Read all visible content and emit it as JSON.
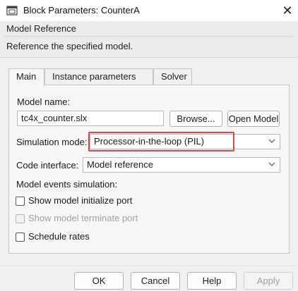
{
  "window": {
    "title": "Block Parameters: CounterA",
    "icon": "block-parameters-icon",
    "close_glyph": "✕"
  },
  "section": {
    "title": "Model Reference",
    "description": "Reference the specified model."
  },
  "tabs": [
    {
      "label": "Main",
      "active": true
    },
    {
      "label": "Instance parameters",
      "active": false
    },
    {
      "label": "Solver",
      "active": false
    }
  ],
  "main": {
    "model_name_label": "Model name:",
    "model_name_value": "tc4x_counter.slx",
    "browse_label": "Browse...",
    "open_model_label": "Open Model",
    "simulation_mode_label": "Simulation mode:",
    "simulation_mode_value": "Processor-in-the-loop (PIL)",
    "code_interface_label": "Code interface:",
    "code_interface_value": "Model reference",
    "model_events_label": "Model events simulation:",
    "checkboxes": [
      {
        "label": "Show model initialize port",
        "checked": false,
        "enabled": true
      },
      {
        "label": "Show model terminate port",
        "checked": false,
        "enabled": false
      },
      {
        "label": "Schedule rates",
        "checked": false,
        "enabled": true
      }
    ]
  },
  "footer": {
    "ok_label": "OK",
    "cancel_label": "Cancel",
    "help_label": "Help",
    "apply_label": "Apply"
  },
  "colors": {
    "highlight": "#e0474c",
    "panel_bg": "#f7f7f7",
    "window_bg": "#f0f0f0"
  }
}
